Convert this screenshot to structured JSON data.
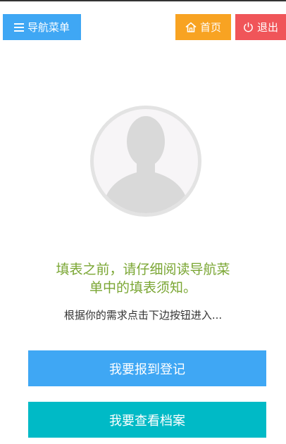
{
  "header": {
    "nav_menu_label": "导航菜单",
    "home_label": "首页",
    "exit_label": "退出",
    "icons": {
      "nav": "menu-icon",
      "home": "home-icon",
      "exit": "power-icon"
    },
    "colors": {
      "nav": "#3fa7f4",
      "home": "#f8a322",
      "exit": "#f05559"
    }
  },
  "profile": {
    "avatar": "default-user-silhouette"
  },
  "notice": {
    "line1": "填表之前，请仔细阅读导航菜",
    "line2": "单中的填表须知。",
    "color": "#7aa633"
  },
  "hint": "根据你的需求点击下边按钮进入...",
  "actions": {
    "register_label": "我要报到登记",
    "archive_label": "我要查看档案",
    "colors": {
      "register": "#3fa7f4",
      "archive": "#00bac6"
    }
  }
}
